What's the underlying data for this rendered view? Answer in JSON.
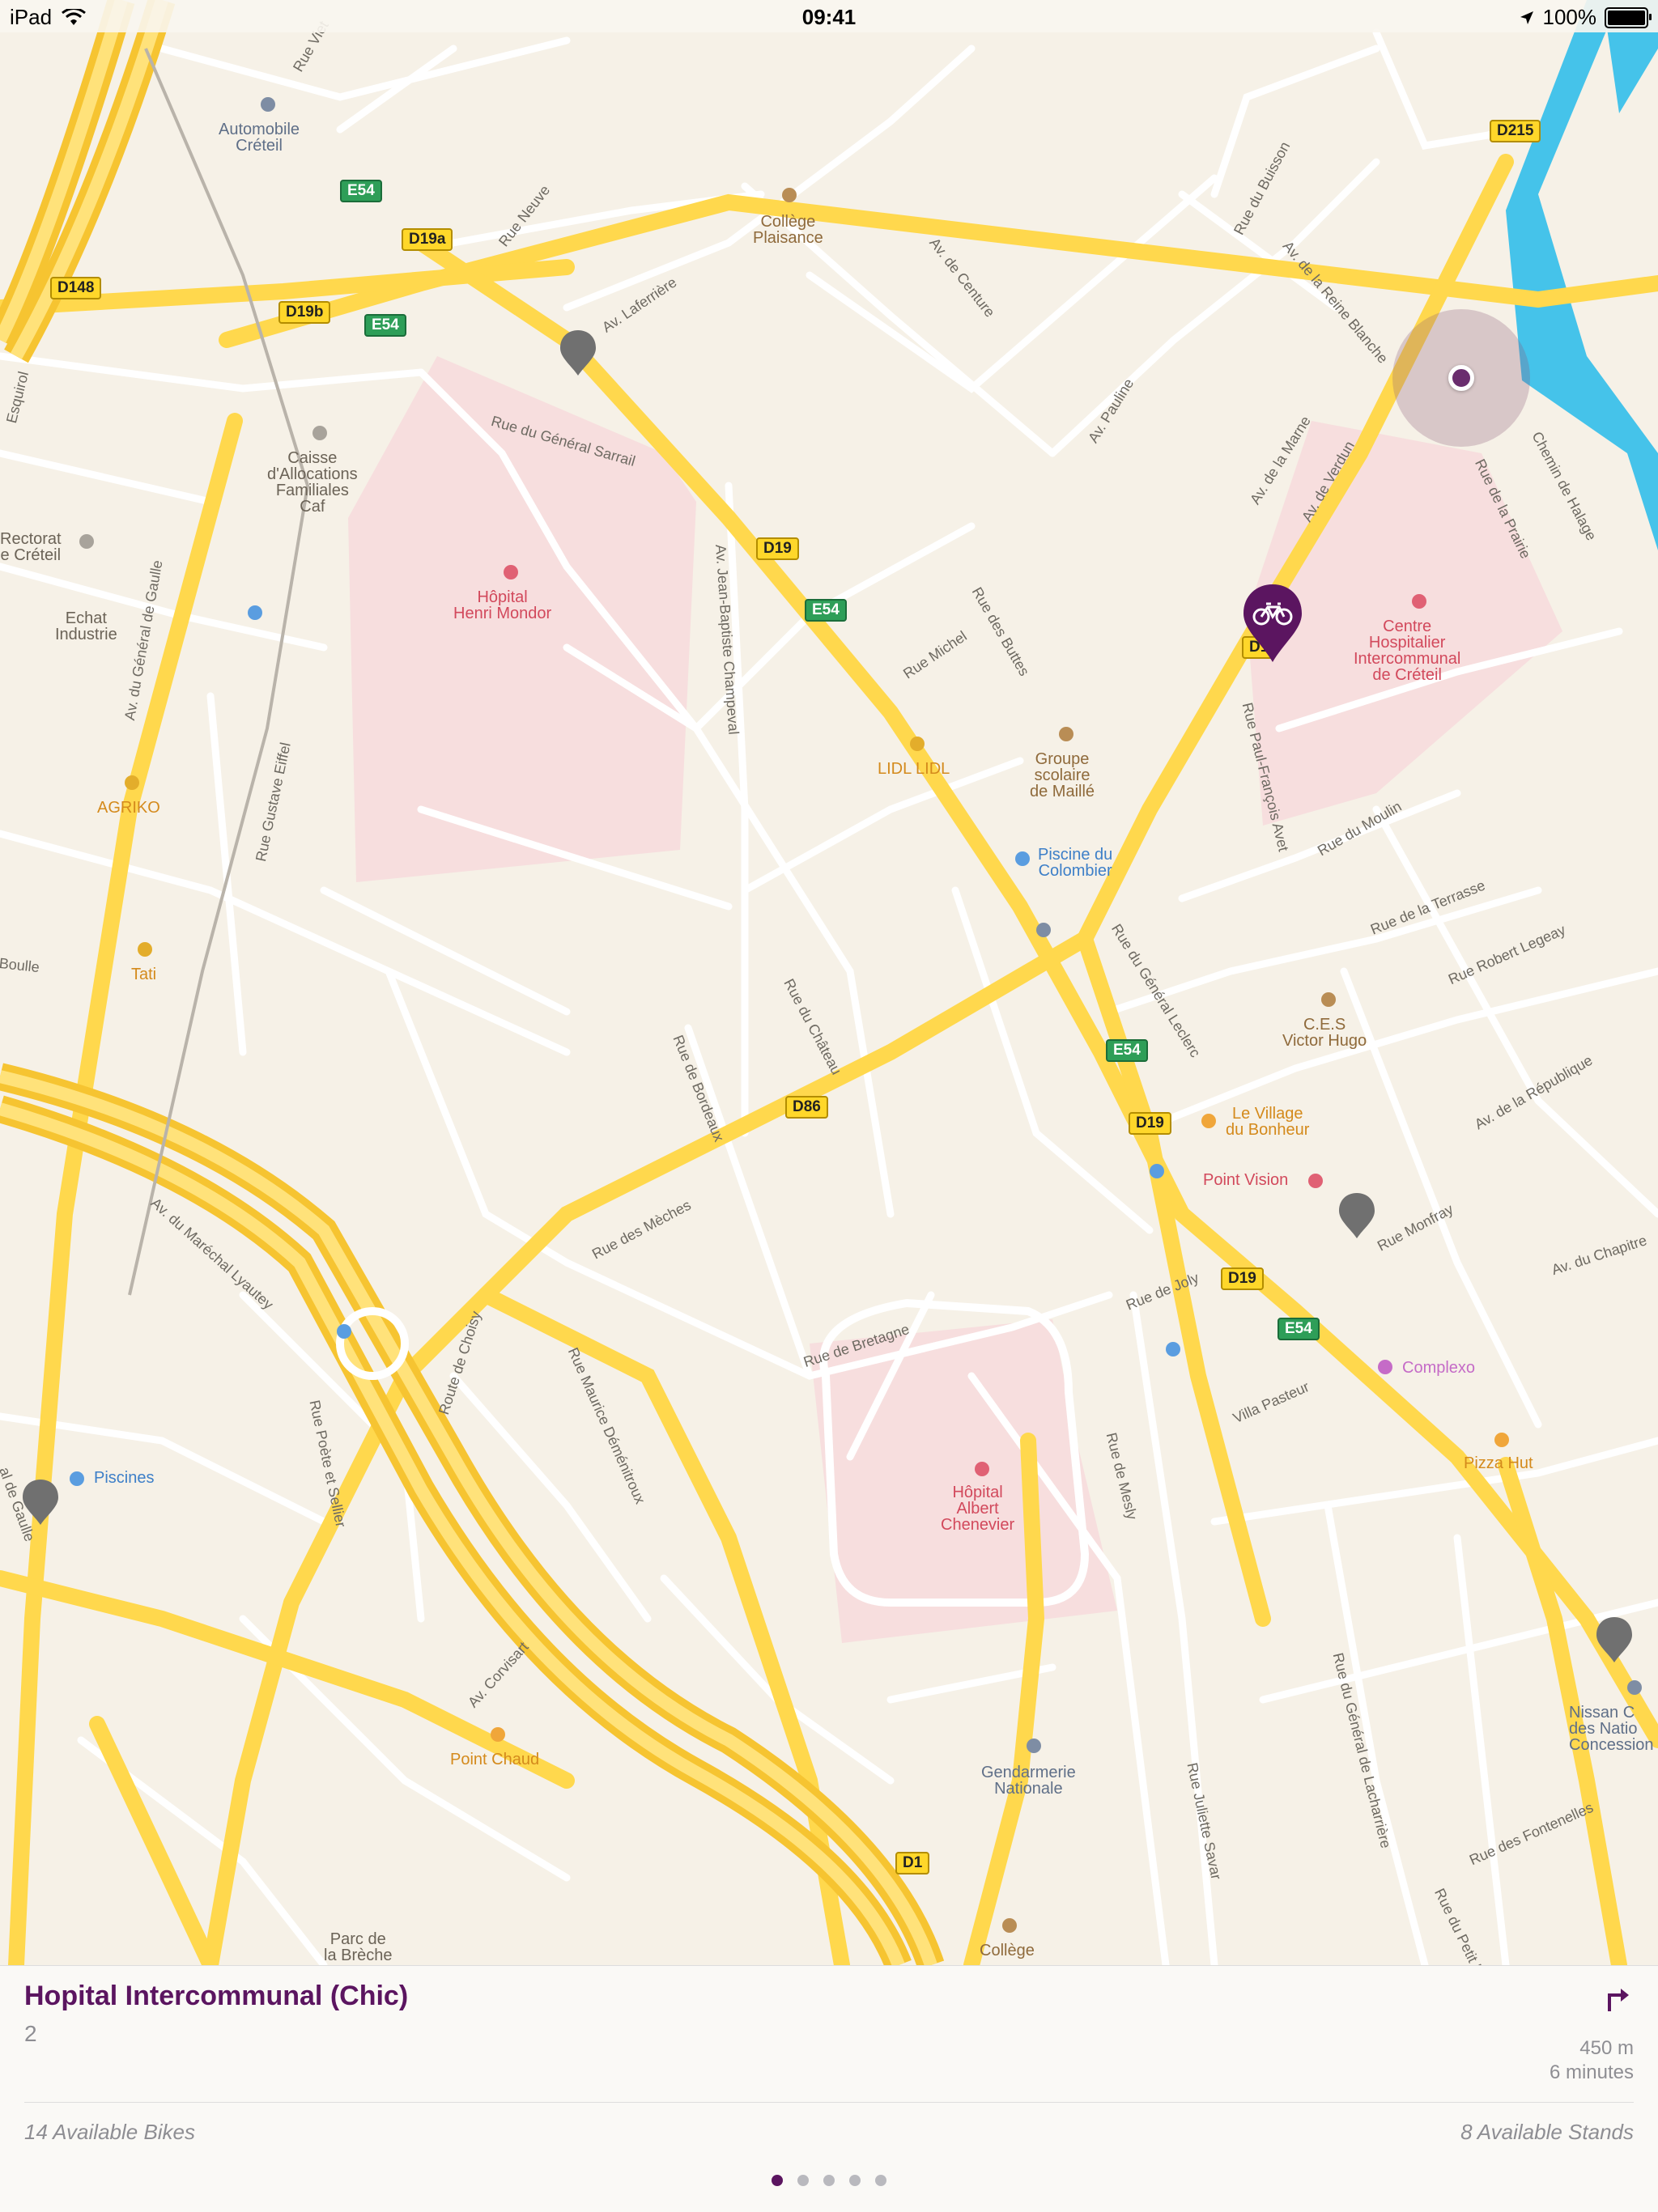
{
  "status_bar": {
    "device": "iPad",
    "time": "09:41",
    "battery": "100%"
  },
  "map": {
    "places": {
      "automobile_creteil": "Automobile\nCréteil",
      "college_plaisance": "Collège\nPlaisance",
      "hopital_henri_mondor": "Hôpital\nHenri Mondor",
      "caisse": "Caisse\nd'Allocations\nFamiliales\nCaf",
      "rectorat": "Rectorat\ne Créteil",
      "echat": "Echat\nIndustrie",
      "agriko": "AGRIKO",
      "tati": "Tati",
      "lidl": "LIDL LIDL",
      "groupe_scolaire": "Groupe\nscolaire\nde Maillé",
      "piscine_colombier": "Piscine du\nColombier",
      "chic": "Centre\nHospitalier\nIntercommunal\nde Créteil",
      "ces_victor_hugo": "C.E.S\nVictor Hugo",
      "village_bonheur": "Le Village\ndu Bonheur",
      "point_vision": "Point Vision",
      "complexo": "Complexo",
      "pizza_hut": "Pizza Hut",
      "hopital_albert": "Hôpital\nAlbert\nChenevier",
      "gendarmerie": "Gendarmerie\nNationale",
      "piscines": "Piscines",
      "point_chaud": "Point Chaud",
      "parc_breche": "Parc de\nla Brèche",
      "college_bottom": "Collège",
      "nissan": "Nissan C\ndes Natio\nConcession"
    },
    "streets": {
      "rue_viet": "Rue Viet",
      "rue_neuve": "Rue Neuve",
      "av_laferriere": "Av. Laferrière",
      "rue_general_sarrail": "Rue du Général Sarrail",
      "av_centure": "Av. de Centure",
      "av_pauline": "Av. Pauline",
      "rue_buisson": "Rue du Buisson",
      "av_reine_blanche": "Av. de la Reine Blanche",
      "av_marne": "Av. de la Marne",
      "av_verdun": "Av. de Verdun",
      "rue_prairie": "Rue de la Prairie",
      "chemin_halage": "Chemin de Halage",
      "av_general_gaulle": "Av. du Général de Gaulle",
      "rue_gustave_eiffel": "Rue Gustave Eiffel",
      "av_jb_champeval": "Av. Jean-Baptiste Champeval",
      "rue_michel": "Rue Michel",
      "rue_buttes": "Rue des Buttes",
      "rue_paul_francois_avet": "Rue Paul-François Avet",
      "rue_moulin": "Rue du Moulin",
      "rue_terrasse": "Rue de la Terrasse",
      "rue_robert_legeay": "Rue Robert Legeay",
      "rue_general_leclerc": "Rue du Général Leclerc",
      "av_republique": "Av. de la République",
      "rue_chateau": "Rue du Château",
      "rue_bordeaux": "Rue de Bordeaux",
      "rue_meches": "Rue des Mèches",
      "av_chapitre": "Av. du Chapitre",
      "rue_monfray": "Rue Monfray",
      "rue_joly": "Rue de Joly",
      "av_marechal_lyautey": "Av. du Maréchal Lyautey",
      "route_choisy": "Route de Choisy",
      "rue_maurice_dementroux": "Rue Maurice Déménitroux",
      "rue_bretagne": "Rue de Bretagne",
      "villa_pasteur": "Villa Pasteur",
      "rue_mesly": "Rue de Mesly",
      "rue_poete_sellier": "Rue Poète et Sellier",
      "av_corvisart": "Av. Corvisart",
      "rue_juliette_savar": "Rue Juliette Savar",
      "rue_general_lacharriere": "Rue du Général de Lacharrière",
      "rue_fontenelles": "Rue des Fontenelles",
      "rue_petit_pre": "Rue du Petit Pré",
      "boulle": "Boulle",
      "esquirol": "Esquirol",
      "de_gaulle_left": "al de Gaulle"
    },
    "shields": {
      "e54_a": "E54",
      "e54_b": "E54",
      "e54_c": "E54",
      "e54_d": "E54",
      "e54_e": "E54",
      "d148": "D148",
      "d19a": "D19a",
      "d19b": "D19b",
      "d19_a": "D19",
      "d19_b": "D19",
      "d19_c": "D19",
      "d19_d": "D1",
      "d86": "D86",
      "d215": "D215",
      "d1": "D1"
    }
  },
  "station": {
    "name": "Hopital Intercommunal (Chic)",
    "number": "2",
    "distance": "450 m",
    "duration": "6 minutes",
    "available_bikes": "14 Available Bikes",
    "available_stands": "8 Available Stands",
    "pages": 5,
    "active_page": 1
  },
  "colors": {
    "accent": "#5b1560",
    "major_road": "#ffd84d",
    "minor_road": "#ffffff",
    "hospital_area": "#f7dede",
    "river": "#45c3ea",
    "pin_gray": "#707070"
  }
}
